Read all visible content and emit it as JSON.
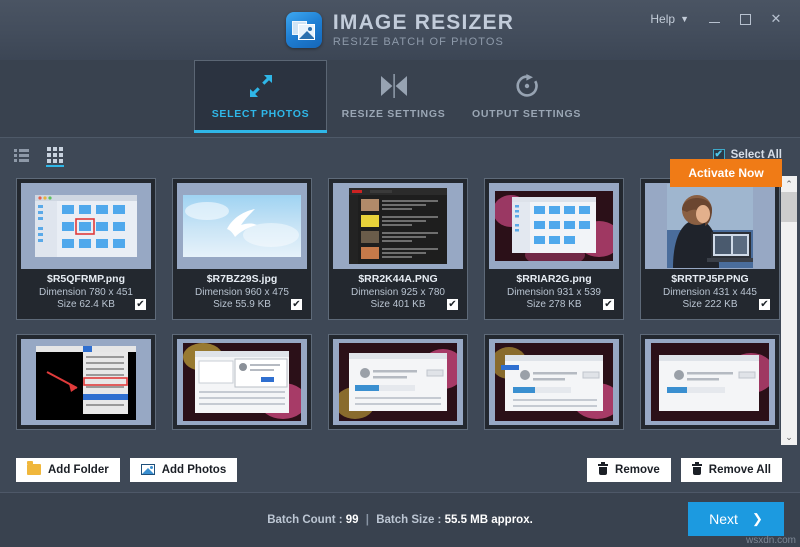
{
  "window": {
    "title": "IMAGE RESIZER",
    "subtitle": "RESIZE BATCH OF PHOTOS",
    "logo_icon": "image-resizer-logo",
    "help_label": "Help",
    "help_chevron_icon": "chevron-down-icon",
    "minimize_icon": "minimize-icon",
    "maximize_icon": "maximize-icon",
    "close_icon": "close-icon",
    "close_glyph": "✕"
  },
  "tabs": [
    {
      "label": "SELECT PHOTOS",
      "icon": "expand-arrows-icon",
      "active": true
    },
    {
      "label": "RESIZE SETTINGS",
      "icon": "resize-compress-icon",
      "active": false
    },
    {
      "label": "OUTPUT SETTINGS",
      "icon": "circular-arrow-icon",
      "active": false
    }
  ],
  "activate": {
    "label": "Activate Now",
    "color": "#f07b16"
  },
  "toolbar": {
    "list_view_icon": "list-view-icon",
    "grid_view_icon": "grid-view-icon",
    "active_view": "grid",
    "select_all_label": "Select All",
    "select_all_checked": true,
    "check_glyph": "✔"
  },
  "photos": [
    {
      "name": "$R5QFRMP.png",
      "dimension": "Dimension 780 x 451",
      "size": "Size 62.4 KB",
      "checked": true,
      "thumb": "finder-window"
    },
    {
      "name": "$R7BZ29S.jpg",
      "dimension": "Dimension 960 x 475",
      "size": "Size 55.9 KB",
      "checked": true,
      "thumb": "sky-bird"
    },
    {
      "name": "$RR2K44A.PNG",
      "dimension": "Dimension 925 x 780",
      "size": "Size 401 KB",
      "checked": true,
      "thumb": "dark-video-list"
    },
    {
      "name": "$RRIAR2G.png",
      "dimension": "Dimension 931 x 539",
      "size": "Size 278 KB",
      "checked": true,
      "thumb": "finder-on-pink"
    },
    {
      "name": "$RRTPJ5P.PNG",
      "dimension": "Dimension 431 x 445",
      "size": "Size 222 KB",
      "checked": true,
      "thumb": "woman-laptop"
    },
    {
      "name": "",
      "dimension": "",
      "size": "",
      "checked": false,
      "thumb": "black-menu-arrow"
    },
    {
      "name": "",
      "dimension": "",
      "size": "",
      "checked": false,
      "thumb": "dialog-pink"
    },
    {
      "name": "",
      "dimension": "",
      "size": "",
      "checked": false,
      "thumb": "installer-pink"
    },
    {
      "name": "",
      "dimension": "",
      "size": "",
      "checked": false,
      "thumb": "installer-pink-2"
    },
    {
      "name": "",
      "dimension": "",
      "size": "",
      "checked": false,
      "thumb": "installer-pink-3"
    }
  ],
  "scrollbar": {
    "up_icon": "chevron-up-icon",
    "down_icon": "chevron-down-icon",
    "up_glyph": "⌃",
    "down_glyph": "⌄"
  },
  "actions": {
    "add_folder_label": "Add Folder",
    "add_folder_icon": "folder-icon",
    "add_photos_label": "Add Photos",
    "add_photos_icon": "photo-icon",
    "remove_label": "Remove",
    "remove_all_label": "Remove All",
    "trash_icon": "trash-icon"
  },
  "status": {
    "batch_count_label": "Batch Count :",
    "batch_count_value": "99",
    "separator": "|",
    "batch_size_label": "Batch Size :",
    "batch_size_value": "55.5 MB approx.",
    "next_label": "Next",
    "next_arrow_icon": "chevron-right-icon",
    "next_arrow_glyph": "❯",
    "watermark": "wsxdn.com"
  }
}
